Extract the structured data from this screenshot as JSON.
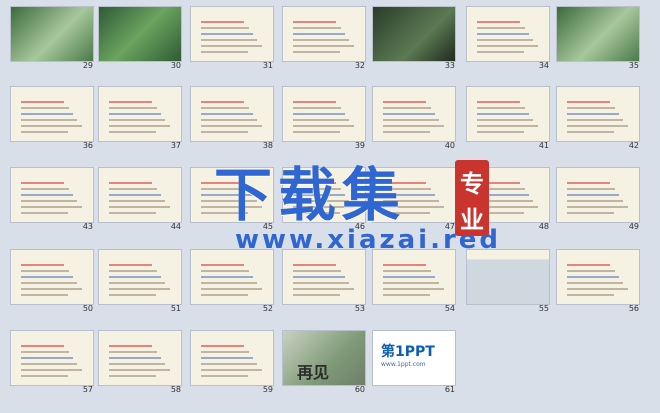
{
  "watermark": {
    "big": "下载集",
    "url": "www.xiazai.red",
    "seal_top": "专",
    "seal_bottom": "业"
  },
  "slides": [
    {
      "n": "29",
      "kind": "green"
    },
    {
      "n": "30",
      "kind": "koi"
    },
    {
      "n": "31",
      "kind": "text"
    },
    {
      "n": "32",
      "kind": "text"
    },
    {
      "n": "33",
      "kind": "dark"
    },
    {
      "n": "34",
      "kind": "text"
    },
    {
      "n": "35",
      "kind": "green"
    },
    {
      "n": "36",
      "kind": "text"
    },
    {
      "n": "37",
      "kind": "text"
    },
    {
      "n": "38",
      "kind": "text"
    },
    {
      "n": "39",
      "kind": "text"
    },
    {
      "n": "40",
      "kind": "text"
    },
    {
      "n": "41",
      "kind": "text"
    },
    {
      "n": "42",
      "kind": "text"
    },
    {
      "n": "43",
      "kind": "text"
    },
    {
      "n": "44",
      "kind": "text"
    },
    {
      "n": "45",
      "kind": "text"
    },
    {
      "n": "46",
      "kind": "text"
    },
    {
      "n": "47",
      "kind": "text"
    },
    {
      "n": "48",
      "kind": "text"
    },
    {
      "n": "49",
      "kind": "text"
    },
    {
      "n": "50",
      "kind": "text"
    },
    {
      "n": "51",
      "kind": "text"
    },
    {
      "n": "52",
      "kind": "text"
    },
    {
      "n": "53",
      "kind": "text"
    },
    {
      "n": "54",
      "kind": "text"
    },
    {
      "n": "55",
      "kind": "building"
    },
    {
      "n": "56",
      "kind": "text"
    },
    {
      "n": "57",
      "kind": "text"
    },
    {
      "n": "58",
      "kind": "text"
    },
    {
      "n": "59",
      "kind": "text"
    },
    {
      "n": "60",
      "kind": "final",
      "label": "再见"
    },
    {
      "n": "61",
      "kind": "ppt",
      "label": "第1PPT",
      "sublabel": "www.1ppt.com"
    }
  ]
}
